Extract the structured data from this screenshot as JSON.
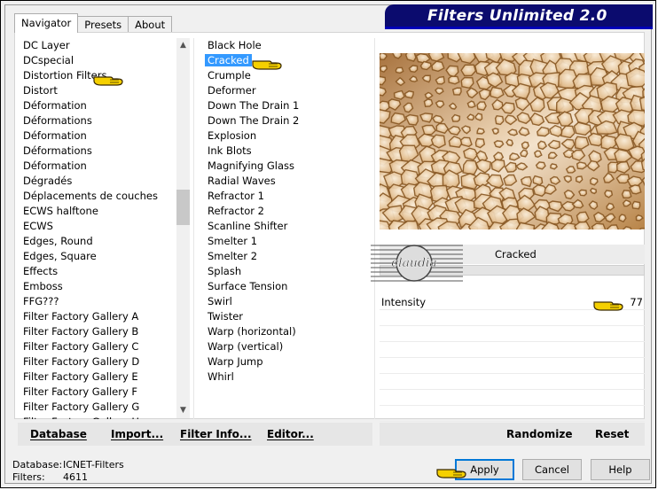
{
  "tabs": [
    "Navigator",
    "Presets",
    "About"
  ],
  "app_title": "Filters Unlimited 2.0",
  "categories": [
    "DC Layer",
    "DCspecial",
    "Distortion Filters",
    "Distort",
    "Déformation",
    "Déformations",
    "Déformation",
    "Déformations",
    "Déformation",
    "Dégradés",
    "Déplacements de couches",
    "ECWS halftone",
    "ECWS",
    "Edges, Round",
    "Edges, Square",
    "Effects",
    "Emboss",
    "FFG???",
    "Filter Factory Gallery A",
    "Filter Factory Gallery B",
    "Filter Factory Gallery C",
    "Filter Factory Gallery D",
    "Filter Factory Gallery E",
    "Filter Factory Gallery F",
    "Filter Factory Gallery G",
    "Filter Factory Gallery H"
  ],
  "filters": [
    "Black Hole",
    "Cracked",
    "Crumple",
    "Deformer",
    "Down The Drain 1",
    "Down The Drain 2",
    "Explosion",
    "Ink Blots",
    "Magnifying Glass",
    "Radial Waves",
    "Refractor 1",
    "Refractor 2",
    "Scanline Shifter",
    "Smelter 1",
    "Smelter 2",
    "Splash",
    "Surface Tension",
    "Swirl",
    "Twister",
    "Warp (horizontal)",
    "Warp (vertical)",
    "Warp Jump",
    "Whirl"
  ],
  "selected_category": "Distortion Filters",
  "selected_filter": "Cracked",
  "filter_name_display": "Cracked",
  "params": [
    {
      "label": "Intensity",
      "value": "77"
    }
  ],
  "watermark_text": "claudia",
  "bottom_left": {
    "database": "Database",
    "import": "Import...",
    "filter_info": "Filter Info...",
    "editor": "Editor..."
  },
  "bottom_right": {
    "randomize": "Randomize",
    "reset": "Reset"
  },
  "status": {
    "database_label": "Database:",
    "database_value": "ICNET-Filters",
    "filters_label": "Filters:",
    "filters_value": "4611"
  },
  "buttons": {
    "apply": "Apply",
    "cancel": "Cancel",
    "help": "Help"
  },
  "colors": {
    "banner": "#0b0b6e",
    "selection": "#3399ff",
    "preview_tone": "#c89e6e",
    "hand": "#f5d000"
  }
}
